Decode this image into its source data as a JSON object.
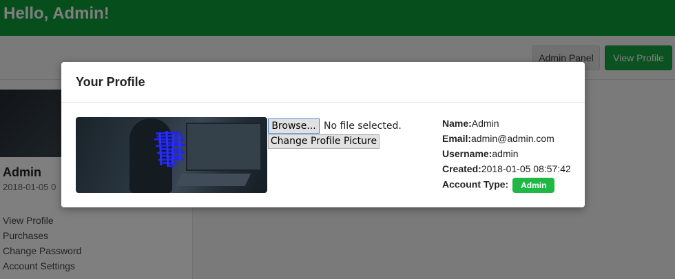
{
  "header": {
    "greeting": "Hello, Admin!"
  },
  "actions": {
    "admin_panel_label": "Admin Panel",
    "view_profile_label": "View Profile"
  },
  "sidebar": {
    "name": "Admin",
    "date": "2018-01-05 0",
    "links": [
      {
        "label": "View Profile"
      },
      {
        "label": "Purchases"
      },
      {
        "label": "Change Password"
      },
      {
        "label": "Account Settings"
      }
    ]
  },
  "modal": {
    "title": "Your Profile",
    "browse_label": "Browse...",
    "file_status": "No file selected.",
    "change_picture_label": "Change Profile Picture",
    "fields": {
      "name_label": "Name:",
      "name_value": "Admin",
      "email_label": "Email:",
      "email_value": "admin@admin.com",
      "username_label": "Username:",
      "username_value": "admin",
      "created_label": "Created:",
      "created_value": "2018-01-05 08:57:42",
      "account_type_label": "Account Type:",
      "account_type_value": "Admin"
    }
  },
  "colors": {
    "brand_green": "#0f9d3a",
    "badge_green": "#1fb844"
  }
}
